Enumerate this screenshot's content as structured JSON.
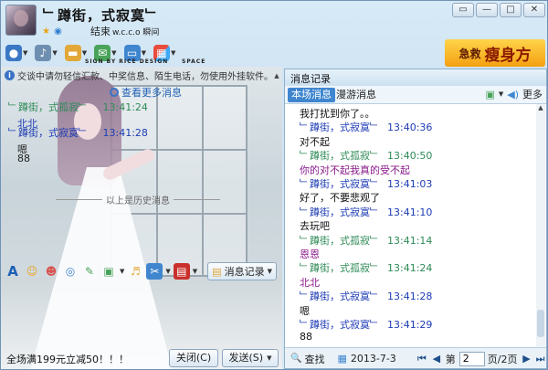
{
  "title": {
    "contact_name": "﹂蹲街，式寂寞﹂",
    "status": "结束",
    "status_extra": "w.c.c.o 瞬间",
    "watermark_left": "SIGN BY RICE DESIGN",
    "watermark_right": "SPACE"
  },
  "window_controls": [
    "▭",
    "—",
    "□",
    "✕"
  ],
  "ad_banner": {
    "small": "急救",
    "big": "瘦身方"
  },
  "notice": "交谈中请勿轻信汇款、中奖信息、陌生电话，勿使用外挂软件。",
  "more_messages": "查看更多消息",
  "history_marker": "以上是历史消息",
  "chat": [
    {
      "sender": "﹂蹲街，式孤寂﹂",
      "time": "13:41:24",
      "text": "北北",
      "sender_color": "#2e8b57",
      "text_color": "#1e3cb4"
    },
    {
      "sender": "﹂蹲街，式寂寞﹂",
      "time": "13:41:28",
      "text": "嗯",
      "sender_color": "#1e3cb4",
      "text_color": "#111111"
    },
    {
      "sender": "",
      "time": "",
      "text": "88",
      "sender_color": "#1e3cb4",
      "text_color": "#111111"
    }
  ],
  "input_toolbar": {
    "history_button": "消息记录"
  },
  "bottom": {
    "promo": "全场满199元立减50！！！",
    "close_button": "关闭(C)",
    "send_button": "发送(S)"
  },
  "right_panel": {
    "title": "消息记录",
    "tab_local": "本场消息",
    "tab_roaming": "漫游消息",
    "more": "更多",
    "lines": [
      {
        "kind": "text",
        "text": "我打扰到你了。。",
        "color": "#111111"
      },
      {
        "kind": "head",
        "sender": "﹂蹲街，式寂寞﹂",
        "time": "13:40:36",
        "color": "#1e3cb4"
      },
      {
        "kind": "text",
        "text": "对不起",
        "color": "#111111"
      },
      {
        "kind": "head",
        "sender": "﹂蹲街，式孤寂﹂",
        "time": "13:40:50",
        "color": "#2e8b57"
      },
      {
        "kind": "text",
        "text": "你的对不起我真的受不起",
        "color": "#8b1a8b"
      },
      {
        "kind": "head",
        "sender": "﹂蹲街，式寂寞﹂",
        "time": "13:41:03",
        "color": "#1e3cb4"
      },
      {
        "kind": "text",
        "text": "好了，不要悲观了",
        "color": "#111111"
      },
      {
        "kind": "head",
        "sender": "﹂蹲街，式寂寞﹂",
        "time": "13:41:10",
        "color": "#1e3cb4"
      },
      {
        "kind": "text",
        "text": "去玩吧",
        "color": "#111111"
      },
      {
        "kind": "head",
        "sender": "﹂蹲街，式孤寂﹂",
        "time": "13:41:14",
        "color": "#2e8b57"
      },
      {
        "kind": "text",
        "text": "恩恩",
        "color": "#8b1a8b"
      },
      {
        "kind": "head",
        "sender": "﹂蹲街，式孤寂﹂",
        "time": "13:41:24",
        "color": "#2e8b57"
      },
      {
        "kind": "text",
        "text": "北北",
        "color": "#8b1a8b"
      },
      {
        "kind": "head",
        "sender": "﹂蹲街，式寂寞﹂",
        "time": "13:41:28",
        "color": "#1e3cb4"
      },
      {
        "kind": "text",
        "text": "嗯",
        "color": "#111111"
      },
      {
        "kind": "head",
        "sender": "﹂蹲街，式寂寞﹂",
        "time": "13:41:29",
        "color": "#1e3cb4"
      },
      {
        "kind": "text",
        "text": "88",
        "color": "#111111"
      }
    ],
    "footer": {
      "find": "查找",
      "date": "2013-7-3",
      "page_prefix": "第",
      "page_value": "2",
      "page_suffix": "页/2页"
    }
  },
  "icons": {
    "search": "🔍",
    "calendar": "▦",
    "first": "⏮",
    "prev": "◀",
    "next": "▶",
    "last": "⏭"
  }
}
